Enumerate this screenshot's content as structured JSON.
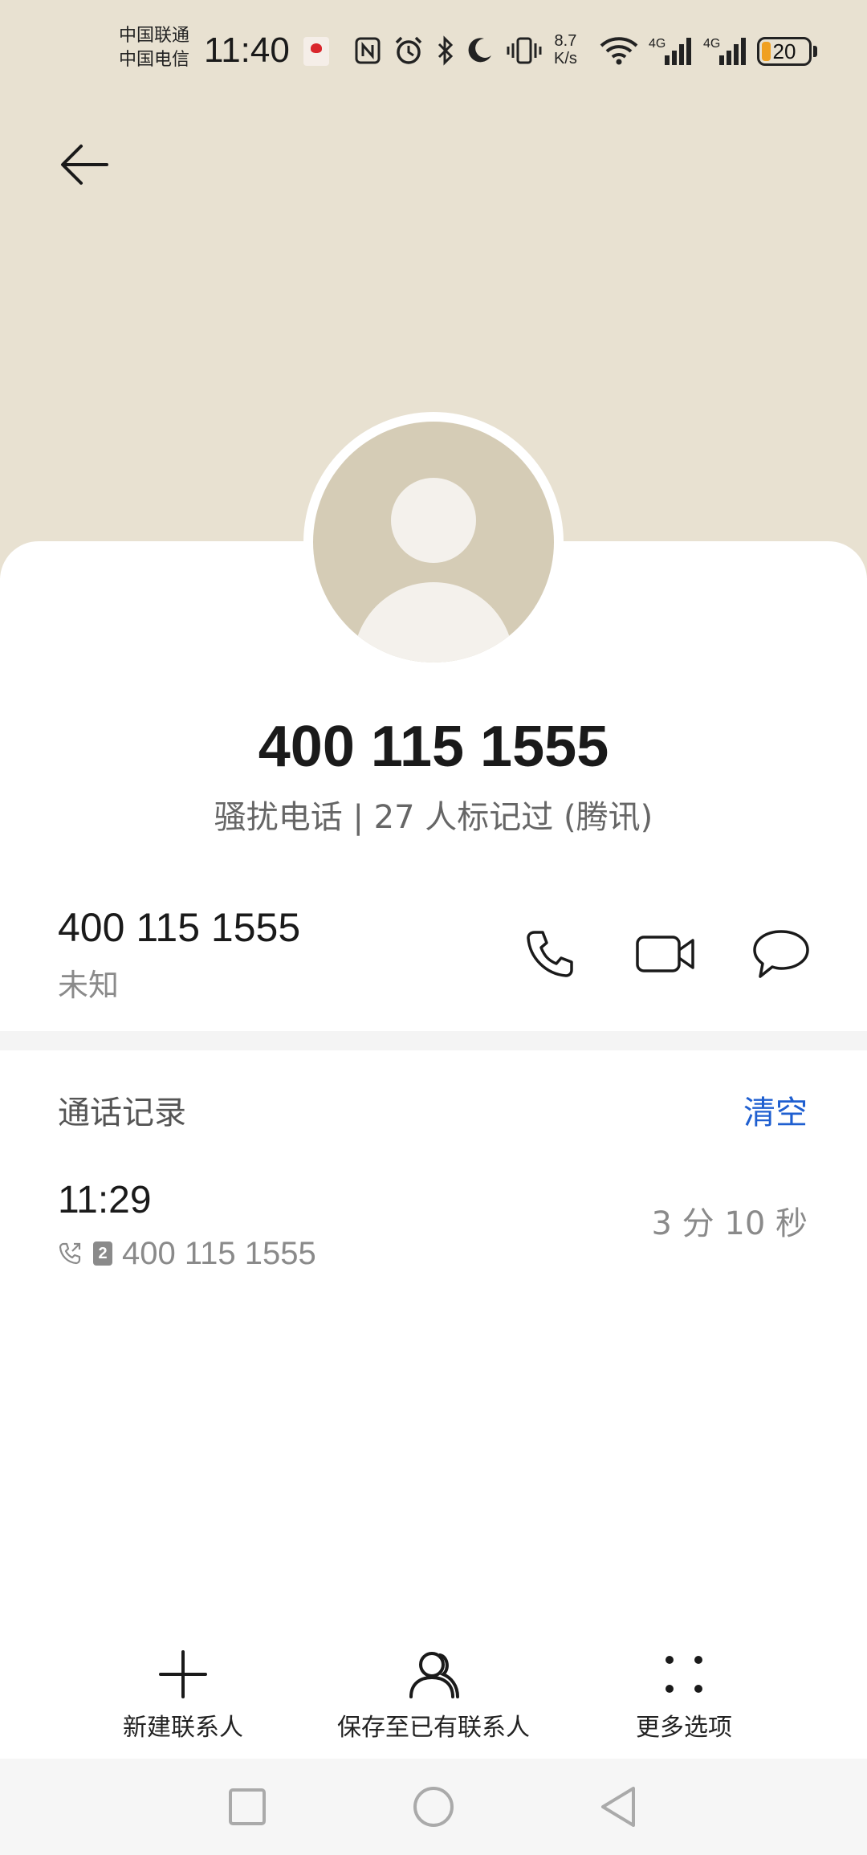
{
  "status_bar": {
    "carrier_1": "中国联通",
    "carrier_2": "中国电信",
    "time": "11:40",
    "net_speed_value": "8.7",
    "net_speed_unit": "K/s",
    "signal_1_label": "4G",
    "signal_2_label": "4G",
    "battery_level": "20",
    "battery_color": "#f0a020"
  },
  "header": {
    "background_color": "#e8e1d1",
    "back_icon": "arrow-left-icon"
  },
  "caller": {
    "number": "400 115 1555",
    "tag": "骚扰电话 | 27 人标记过 (腾讯)"
  },
  "contact": {
    "number": "400 115 1555",
    "type": "未知",
    "actions": [
      "phone-icon",
      "video-call-icon",
      "message-icon"
    ]
  },
  "call_log": {
    "title": "通话记录",
    "clear_label": "清空",
    "clear_color": "#1f5fd0",
    "entries": [
      {
        "time": "11:29",
        "sim": "2",
        "number": "400 115 1555",
        "duration": "3 分 10 秒"
      }
    ]
  },
  "bottom_actions": [
    {
      "label": "新建联系人",
      "icon": "plus-icon"
    },
    {
      "label": "保存至已有联系人",
      "icon": "person-icon"
    },
    {
      "label": "更多选项",
      "icon": "more-dots-icon"
    }
  ],
  "nav_bar": {
    "buttons": [
      "recent-apps-icon",
      "home-icon",
      "back-nav-icon"
    ]
  }
}
